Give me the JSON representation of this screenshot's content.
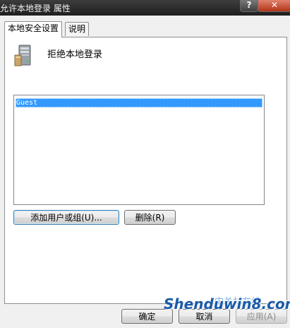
{
  "window": {
    "title": "允许本地登录 属性",
    "help_glyph": "?",
    "close_glyph": "✕"
  },
  "tabs": [
    {
      "label": "本地安全设置",
      "active": true
    },
    {
      "label": "说明",
      "active": false
    }
  ],
  "policy": {
    "icon": "server-computer-icon",
    "title": "拒绝本地登录"
  },
  "list": {
    "items": [
      "Guest"
    ]
  },
  "buttons": {
    "add": "添加用户或组(U)...",
    "remove": "删除(R)",
    "ok": "确定",
    "cancel": "取消",
    "apply": "应用(A)"
  },
  "watermark": {
    "text": "Shenduwin8.com",
    "cn": "中关村在线"
  }
}
